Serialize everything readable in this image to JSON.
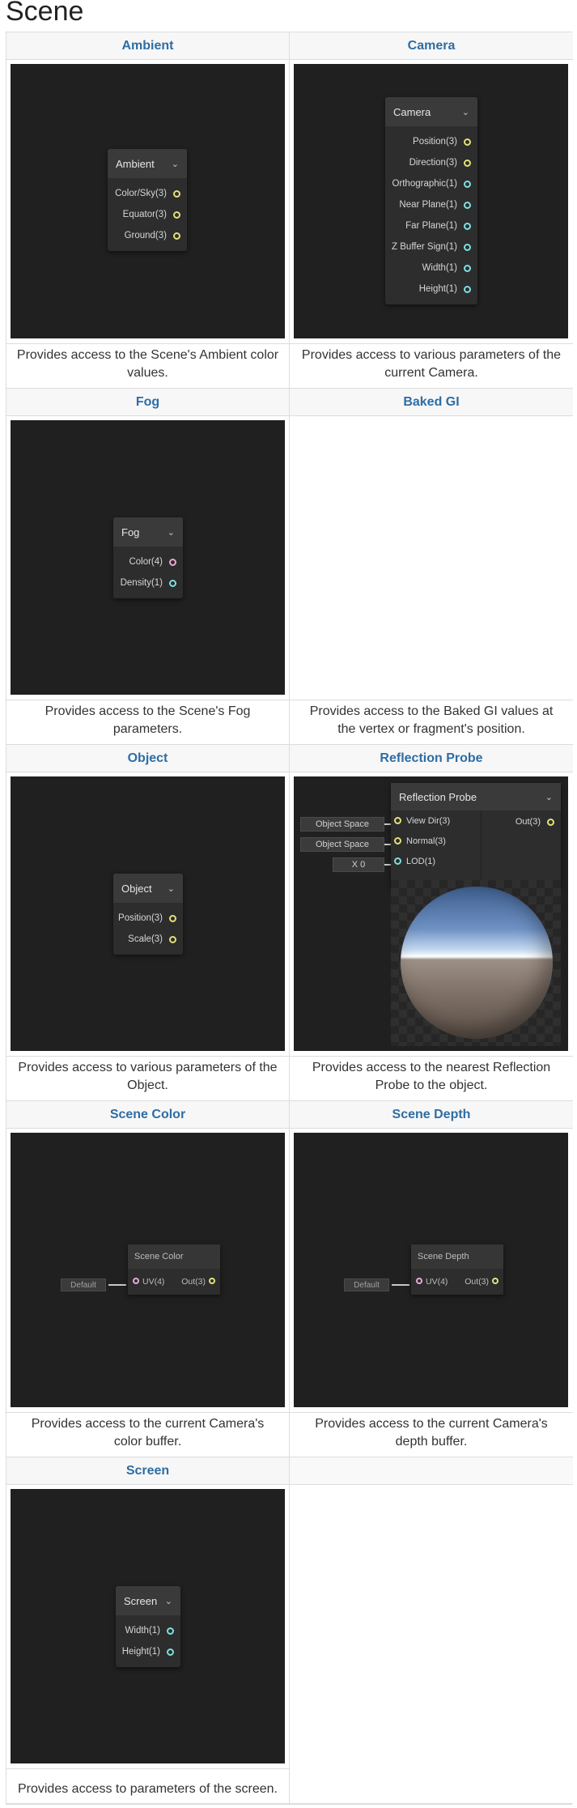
{
  "page_title": "Scene",
  "cells": [
    {
      "title": "Ambient",
      "node": {
        "title": "Ambient",
        "ports": [
          {
            "label": "Color/Sky(3)",
            "color": "yellow"
          },
          {
            "label": "Equator(3)",
            "color": "yellow"
          },
          {
            "label": "Ground(3)",
            "color": "yellow"
          }
        ]
      },
      "description": "Provides access to the Scene's Ambient color values."
    },
    {
      "title": "Camera",
      "node": {
        "title": "Camera",
        "ports": [
          {
            "label": "Position(3)",
            "color": "yellow"
          },
          {
            "label": "Direction(3)",
            "color": "yellow"
          },
          {
            "label": "Orthographic(1)",
            "color": "cyan"
          },
          {
            "label": "Near Plane(1)",
            "color": "cyan"
          },
          {
            "label": "Far Plane(1)",
            "color": "cyan"
          },
          {
            "label": "Z Buffer Sign(1)",
            "color": "cyan"
          },
          {
            "label": "Width(1)",
            "color": "cyan"
          },
          {
            "label": "Height(1)",
            "color": "cyan"
          }
        ]
      },
      "description": "Provides access to various parameters of the current Camera."
    },
    {
      "title": "Fog",
      "node": {
        "title": "Fog",
        "ports": [
          {
            "label": "Color(4)",
            "color": "pink"
          },
          {
            "label": "Density(1)",
            "color": "cyan"
          }
        ]
      },
      "description": "Provides access to the Scene's Fog parameters."
    },
    {
      "title": "Baked GI",
      "description": "Provides access to the Baked GI values at the vertex or fragment's position."
    },
    {
      "title": "Object",
      "node": {
        "title": "Object",
        "ports": [
          {
            "label": "Position(3)",
            "color": "yellow"
          },
          {
            "label": "Scale(3)",
            "color": "yellow"
          }
        ]
      },
      "description": "Provides access to various parameters of the Object."
    },
    {
      "title": "Reflection Probe",
      "node": {
        "title": "Reflection Probe",
        "inputs": [
          {
            "label": "View Dir(3)",
            "chip": "Object Space"
          },
          {
            "label": "Normal(3)",
            "chip": "Object Space"
          },
          {
            "label": "LOD(1)",
            "chip": "X 0"
          }
        ],
        "output": "Out(3)"
      },
      "description": "Provides access to the nearest Reflection Probe to the object."
    },
    {
      "title": "Scene Color",
      "node": {
        "title": "Scene Color",
        "input": "UV(4)",
        "output": "Out(3)",
        "chip": "Default"
      },
      "description": "Provides access to the current Camera's color buffer."
    },
    {
      "title": "Scene Depth",
      "node": {
        "title": "Scene Depth",
        "input": "UV(4)",
        "output": "Out(3)",
        "chip": "Default"
      },
      "description": "Provides access to the current Camera's depth buffer."
    },
    {
      "title": "Screen",
      "node": {
        "title": "Screen",
        "ports": [
          {
            "label": "Width(1)",
            "color": "cyan"
          },
          {
            "label": "Height(1)",
            "color": "cyan"
          }
        ]
      },
      "description": "Provides access to parameters of the screen."
    }
  ],
  "colors": {
    "header_text": "#2e6da4",
    "preview_bg": "#202020",
    "port_yellow": "#e5e07a",
    "port_cyan": "#7ee0e0",
    "port_pink": "#e9a8d8"
  },
  "icons": [
    "chevron-down-icon"
  ]
}
